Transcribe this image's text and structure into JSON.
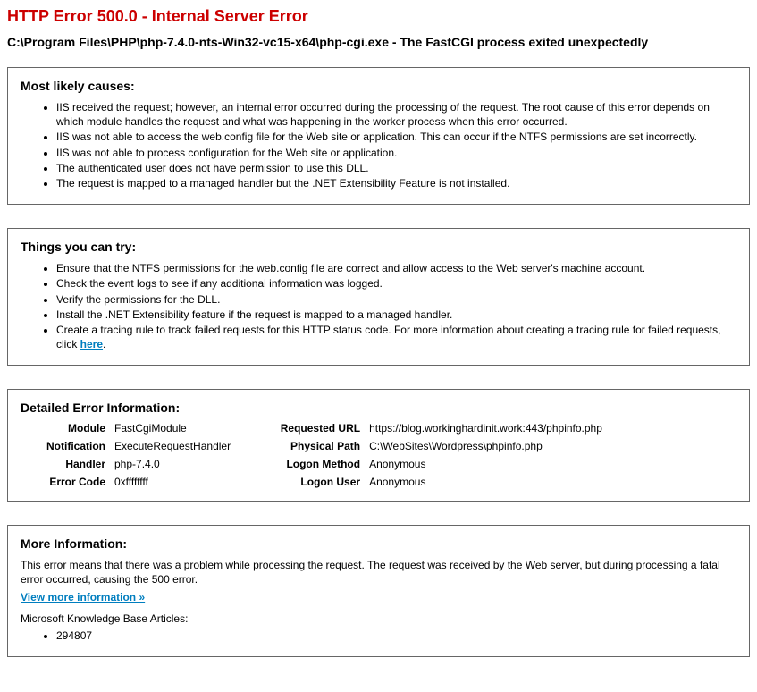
{
  "title": "HTTP Error 500.0 - Internal Server Error",
  "subtitle": "C:\\Program Files\\PHP\\php-7.4.0-nts-Win32-vc15-x64\\php-cgi.exe - The FastCGI process exited unexpectedly",
  "causes": {
    "heading": "Most likely causes:",
    "items": [
      "IIS received the request; however, an internal error occurred during the processing of the request. The root cause of this error depends on which module handles the request and what was happening in the worker process when this error occurred.",
      "IIS was not able to access the web.config file for the Web site or application. This can occur if the NTFS permissions are set incorrectly.",
      "IIS was not able to process configuration for the Web site or application.",
      "The authenticated user does not have permission to use this DLL.",
      "The request is mapped to a managed handler but the .NET Extensibility Feature is not installed."
    ]
  },
  "tries": {
    "heading": "Things you can try:",
    "items": [
      "Ensure that the NTFS permissions for the web.config file are correct and allow access to the Web server's machine account.",
      "Check the event logs to see if any additional information was logged.",
      "Verify the permissions for the DLL.",
      "Install the .NET Extensibility feature if the request is mapped to a managed handler."
    ],
    "last_prefix": "Create a tracing rule to track failed requests for this HTTP status code. For more information about creating a tracing rule for failed requests, click ",
    "last_link": "here",
    "last_suffix": "."
  },
  "detail": {
    "heading": "Detailed Error Information:",
    "left": {
      "module_label": "Module",
      "module_value": "FastCgiModule",
      "notification_label": "Notification",
      "notification_value": "ExecuteRequestHandler",
      "handler_label": "Handler",
      "handler_value": "php-7.4.0",
      "errorcode_label": "Error Code",
      "errorcode_value": "0xffffffff"
    },
    "right": {
      "requrl_label": "Requested URL",
      "requrl_value": "https://blog.workinghardinit.work:443/phpinfo.php",
      "physpath_label": "Physical Path",
      "physpath_value": "C:\\WebSites\\Wordpress\\phpinfo.php",
      "logonmethod_label": "Logon Method",
      "logonmethod_value": "Anonymous",
      "logonuser_label": "Logon User",
      "logonuser_value": "Anonymous"
    }
  },
  "more": {
    "heading": "More Information:",
    "text": "This error means that there was a problem while processing the request. The request was received by the Web server, but during processing a fatal error occurred, causing the 500 error.",
    "link": "View more information »",
    "kb_label": "Microsoft Knowledge Base Articles:",
    "kb_items": [
      "294807"
    ]
  }
}
